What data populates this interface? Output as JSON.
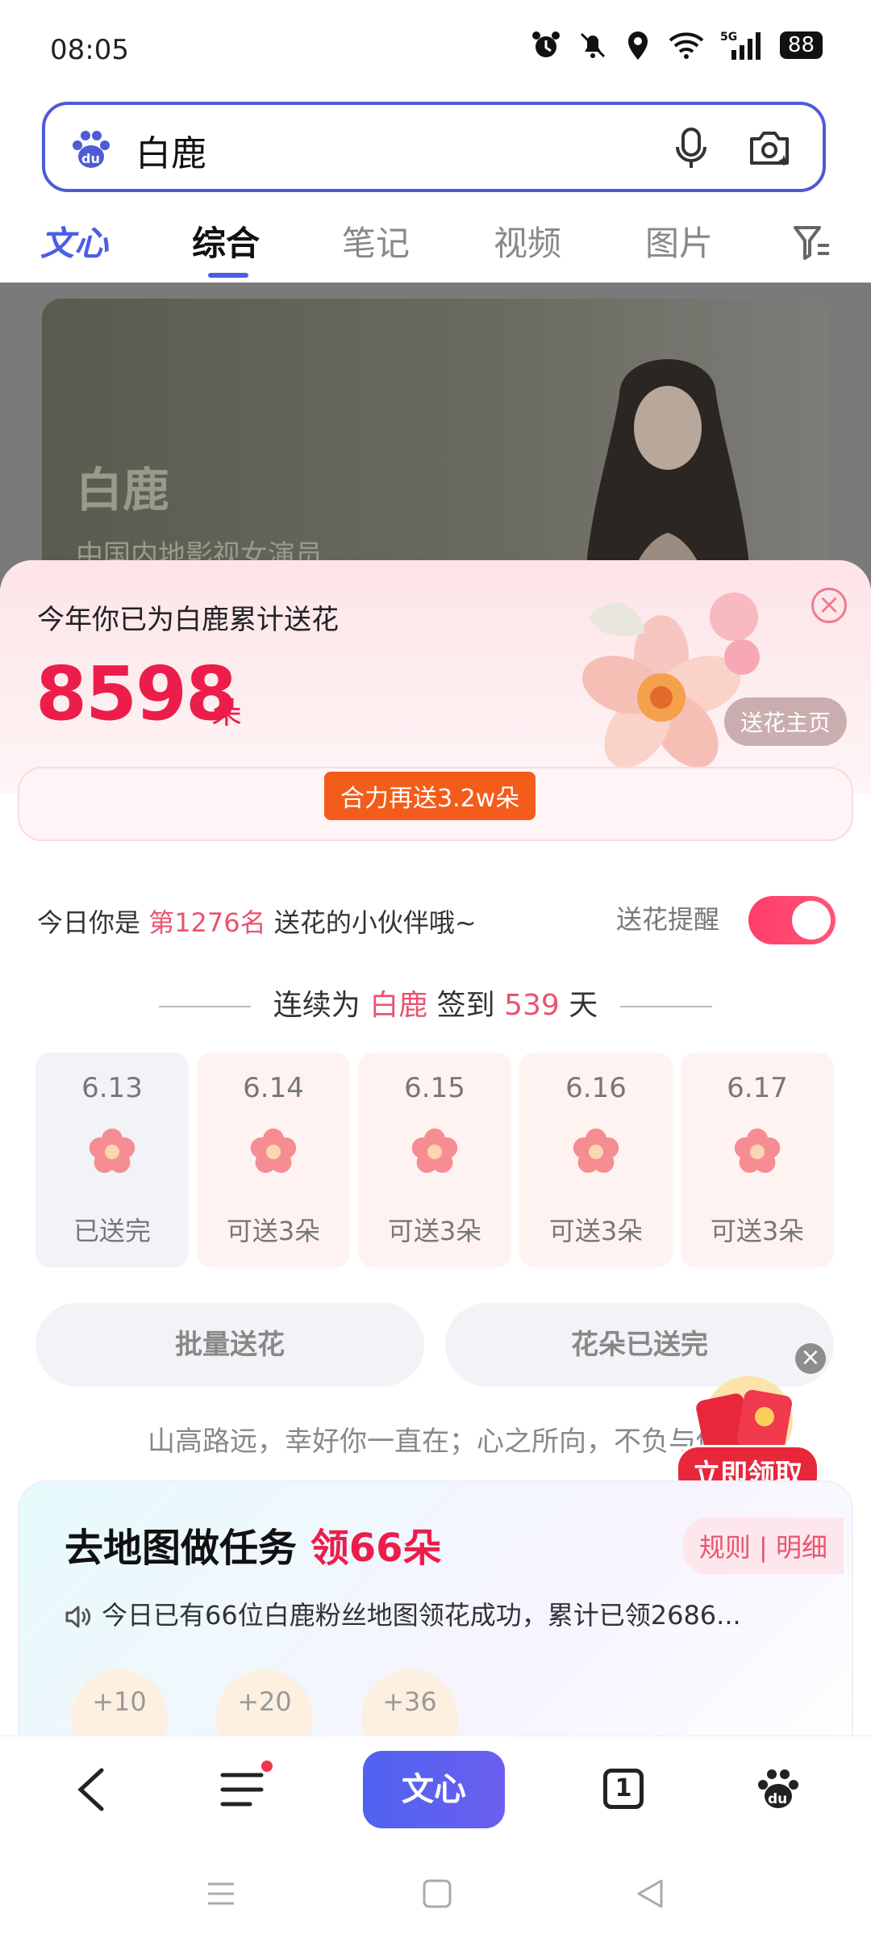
{
  "status": {
    "time": "08:05",
    "battery": "88"
  },
  "search": {
    "query": "白鹿"
  },
  "tabs": [
    {
      "label": "文心"
    },
    {
      "label": "综合"
    },
    {
      "label": "笔记"
    },
    {
      "label": "视频"
    },
    {
      "label": "图片"
    }
  ],
  "hero": {
    "name": "白鹿",
    "subtitle": "中国内地影视女演员"
  },
  "sheet": {
    "cumulative_text": "今年你已为白鹿累计送花",
    "count": "8598",
    "unit": "朵",
    "home_button": "送花主页",
    "together_button": "合力再送3.2w朵",
    "rank_prefix": "今日你是 ",
    "rank_value": "第1276名",
    "rank_suffix": " 送花的小伙伴哦~",
    "remind_label": "送花提醒",
    "streak_prefix": "连续为 ",
    "streak_name": "白鹿",
    "streak_mid": " 签到 ",
    "streak_days": "539",
    "streak_suffix": " 天",
    "days": [
      {
        "date": "6.13",
        "status": "已送完"
      },
      {
        "date": "6.14",
        "status": "可送3朵"
      },
      {
        "date": "6.15",
        "status": "可送3朵"
      },
      {
        "date": "6.16",
        "status": "可送3朵"
      },
      {
        "date": "6.17",
        "status": "可送3朵"
      }
    ],
    "batch_button": "批量送花",
    "done_button": "花朵已送完",
    "quote": "山高路远，幸好你一直在；心之所向，不负与你",
    "redpack_button": "立即领取"
  },
  "task": {
    "title": "去地图做任务 ",
    "reward": "领66朵",
    "rules": "规则 | 明细",
    "notice": "今日已有66位白鹿粉丝地图领花成功，累计已领2686...",
    "bubbles": [
      "+10",
      "+20",
      "+36"
    ]
  },
  "bottomnav": {
    "wenxin": "文心",
    "tab_count": "1"
  },
  "colors": {
    "accent": "#4b5ee5",
    "pink": "#ec1d4a",
    "toggle": "#ff3d6a"
  }
}
